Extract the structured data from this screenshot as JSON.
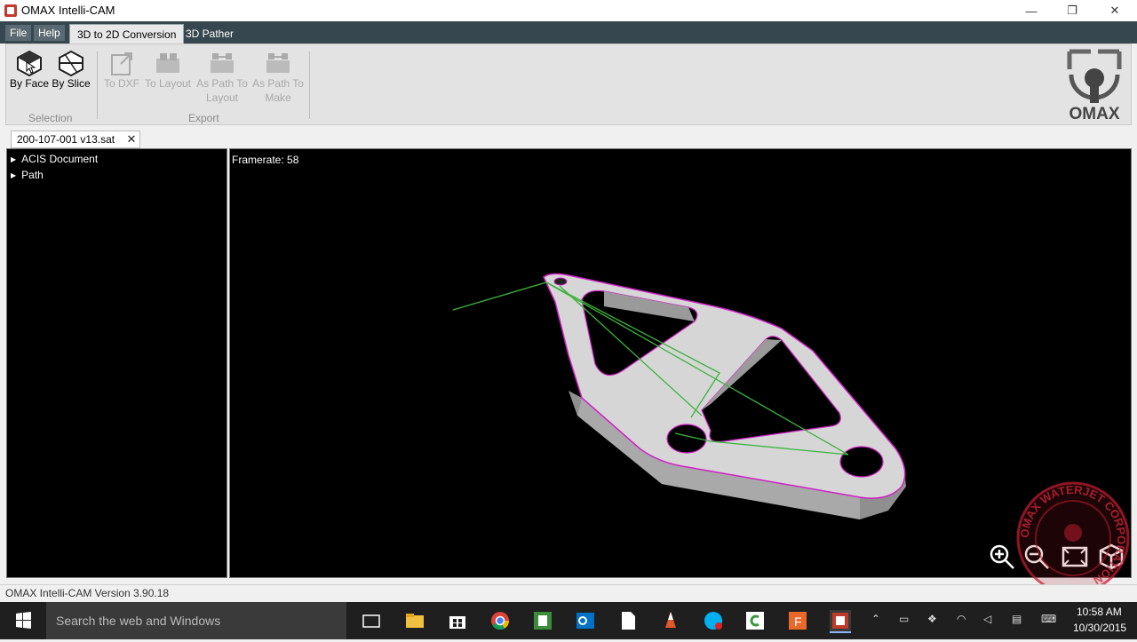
{
  "window": {
    "title": "OMAX Intelli-CAM",
    "minimize": "—",
    "maximize": "❐",
    "close": "✕"
  },
  "menu": {
    "file": "File",
    "help": "Help"
  },
  "tabs": {
    "conversion": "3D to 2D Conversion",
    "pather": "3D Pather"
  },
  "ribbon": {
    "by_face": "By Face",
    "by_slice": "By Slice",
    "selection_group": "Selection",
    "to_dxf": "To DXF",
    "to_layout": "To Layout",
    "as_path_to_layout_1": "As Path To",
    "as_path_to_layout_2": "Layout",
    "as_path_to_make_1": "As Path To",
    "as_path_to_make_2": "Make",
    "export_group": "Export",
    "logo_text": "OMAX"
  },
  "document": {
    "tab_name": "200-107-001 v13.sat",
    "close": "✕"
  },
  "tree": {
    "items": [
      "ACIS Document",
      "Path"
    ]
  },
  "viewport": {
    "framerate": "Framerate: 58"
  },
  "status": {
    "version": "OMAX Intelli-CAM Version 3.90.18"
  },
  "taskbar": {
    "search_placeholder": "Search the web and Windows",
    "time": "10:58 AM",
    "date": "10/30/2015"
  },
  "watermark": {
    "text": "OMAX WATERJET CORPORATION"
  },
  "colors": {
    "accent": "#37474f",
    "viewport_bg": "#000000",
    "outline": "#d020c8",
    "path": "#3cb43c",
    "part": "#d4d4d4"
  }
}
